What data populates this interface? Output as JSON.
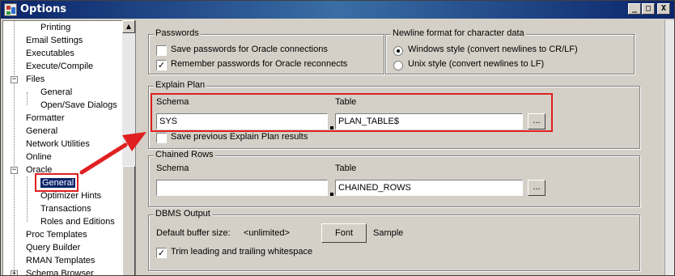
{
  "window": {
    "title": "Options",
    "minimize": "_",
    "maximize": "□",
    "close": "X"
  },
  "tree": {
    "items": [
      {
        "label": "Printing"
      },
      {
        "label": "Email Settings"
      },
      {
        "label": "Executables"
      },
      {
        "label": "Execute/Compile"
      },
      {
        "label": "Files",
        "expander": "−"
      },
      {
        "label": "General"
      },
      {
        "label": "Open/Save Dialogs"
      },
      {
        "label": "Formatter"
      },
      {
        "label": "General"
      },
      {
        "label": "Network Utilities"
      },
      {
        "label": "Online"
      },
      {
        "label": "Oracle",
        "expander": "−"
      },
      {
        "label": "General"
      },
      {
        "label": "Optimizer Hints"
      },
      {
        "label": "Transactions"
      },
      {
        "label": "Roles and Editions"
      },
      {
        "label": "Proc Templates"
      },
      {
        "label": "Query Builder"
      },
      {
        "label": "RMAN Templates"
      },
      {
        "label": "Schema Browser",
        "expander": "+"
      }
    ]
  },
  "passwords": {
    "legend": "Passwords",
    "save_label": "Save passwords for Oracle connections",
    "save_checked": false,
    "remember_label": "Remember passwords for Oracle reconnects",
    "remember_checked": true
  },
  "newline": {
    "legend": "Newline format for character data",
    "windows_label": "Windows style (convert newlines to CR/LF)",
    "unix_label": "Unix style (convert newlines to LF)",
    "selected": "windows"
  },
  "explain_plan": {
    "legend": "Explain Plan",
    "schema_label": "Schema",
    "table_label": "Table",
    "schema_value": "SYS",
    "table_value": "PLAN_TABLE$",
    "browse_label": "...",
    "save_previous_label": "Save previous Explain Plan results",
    "save_previous_checked": false
  },
  "chained_rows": {
    "legend": "Chained Rows",
    "schema_label": "Schema",
    "table_label": "Table",
    "schema_value": "",
    "table_value": "CHAINED_ROWS",
    "browse_label": "..."
  },
  "dbms_output": {
    "legend": "DBMS Output",
    "buffer_label": "Default buffer size:",
    "buffer_value": "<unlimited>",
    "font_button": "Font",
    "sample_label": "Sample",
    "trim_label": "Trim leading and trailing whitespace",
    "trim_checked": true
  },
  "annotation": {
    "color": "#e02020"
  }
}
